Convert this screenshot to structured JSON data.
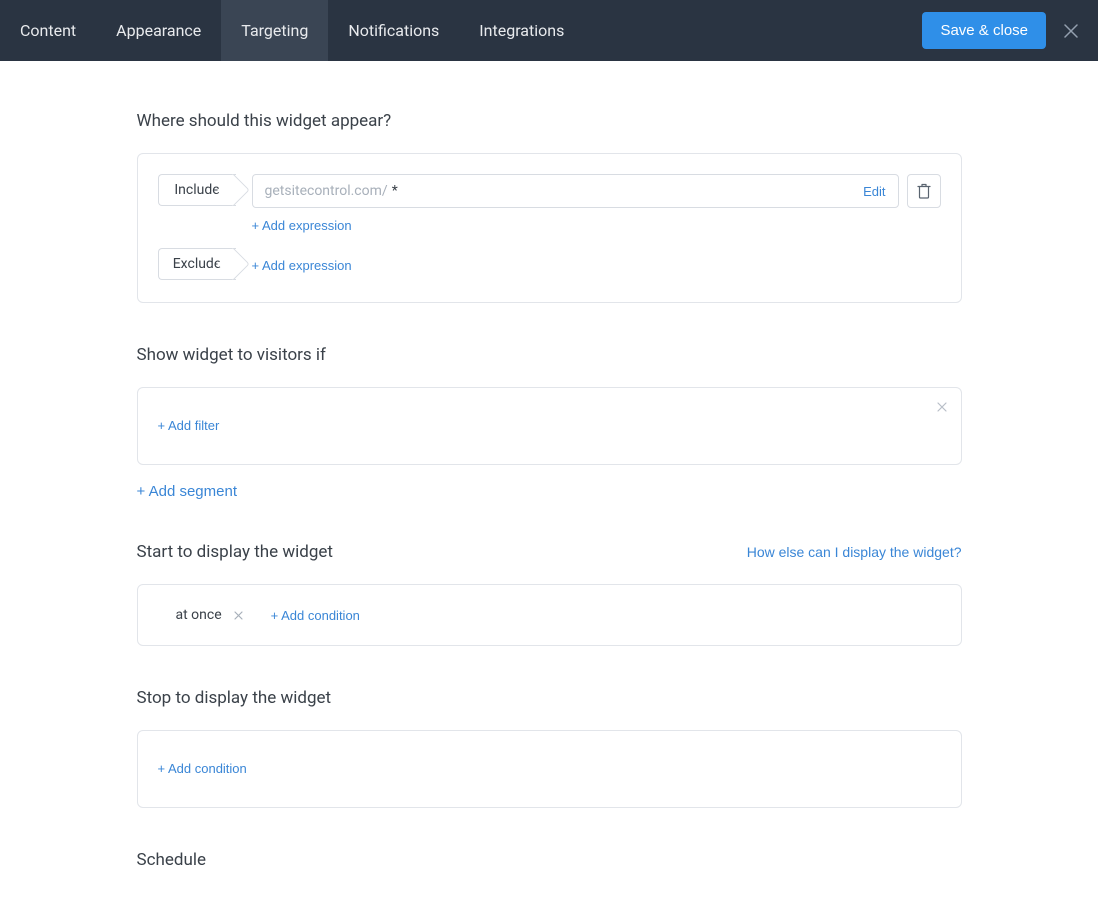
{
  "header": {
    "tabs": [
      "Content",
      "Appearance",
      "Targeting",
      "Notifications",
      "Integrations"
    ],
    "active_tab": "Targeting",
    "save_label": "Save & close"
  },
  "where": {
    "title": "Where should this widget appear?",
    "include_label": "Include",
    "exclude_label": "Exclude",
    "domain_prefix": "getsitecontrol.com/",
    "url_pattern": "*",
    "edit_label": "Edit",
    "add_expression_label": "+ Add expression"
  },
  "visitors": {
    "title": "Show widget to visitors if",
    "add_filter_label": "+ Add filter",
    "add_segment_label": "+ Add segment"
  },
  "start": {
    "title": "Start to display the widget",
    "help_link": "How else can I display the widget?",
    "condition": "at once",
    "add_condition_label": "+ Add condition"
  },
  "stop": {
    "title": "Stop to display the widget",
    "add_condition_label": "+ Add condition"
  },
  "schedule": {
    "title": "Schedule"
  }
}
